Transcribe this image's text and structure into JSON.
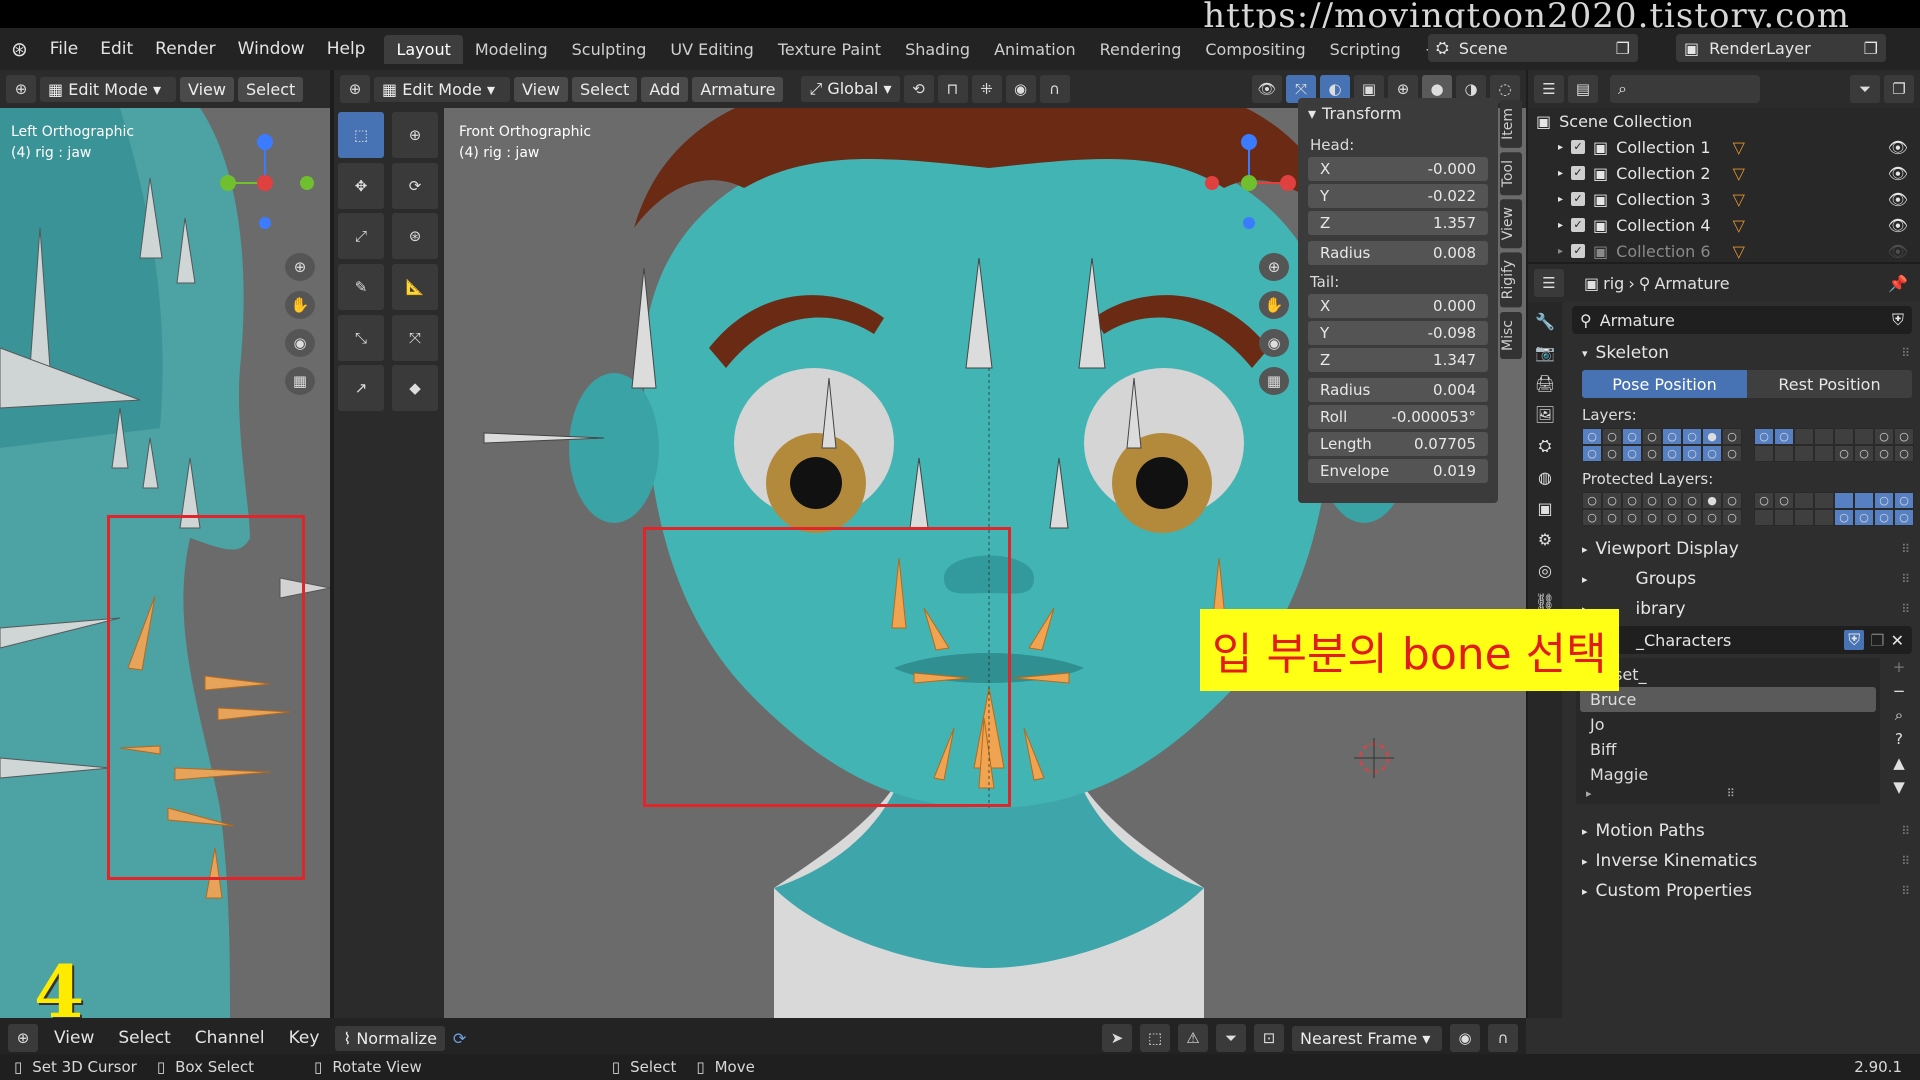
{
  "watermark": "https://movingtoon2020.tistory.com",
  "menu": [
    "File",
    "Edit",
    "Render",
    "Window",
    "Help"
  ],
  "workspaces": [
    "Layout",
    "Modeling",
    "Sculpting",
    "UV Editing",
    "Texture Paint",
    "Shading",
    "Animation",
    "Rendering",
    "Compositing",
    "Scripting"
  ],
  "scene": {
    "label": "Scene",
    "layer": "RenderLayer"
  },
  "left_view": {
    "mode": "Edit Mode",
    "view": "View",
    "select": "Select",
    "title": "Left Orthographic",
    "subtitle": "(4) rig : jaw"
  },
  "main_view": {
    "mode": "Edit Mode",
    "view": "View",
    "select": "Select",
    "add": "Add",
    "armature": "Armature",
    "orientation": "Global",
    "title": "Front Orthographic",
    "subtitle": "(4) rig : jaw"
  },
  "transform": {
    "title": "Transform",
    "head_label": "Head:",
    "tail_label": "Tail:",
    "head": [
      {
        "k": "X",
        "v": "-0.000"
      },
      {
        "k": "Y",
        "v": "-0.022"
      },
      {
        "k": "Z",
        "v": "1.357"
      },
      {
        "k": "Radius",
        "v": "0.008"
      }
    ],
    "tail": [
      {
        "k": "X",
        "v": "0.000"
      },
      {
        "k": "Y",
        "v": "-0.098"
      },
      {
        "k": "Z",
        "v": "1.347"
      },
      {
        "k": "Radius",
        "v": "0.004"
      }
    ],
    "extra": [
      {
        "k": "Roll",
        "v": "-0.000053°"
      },
      {
        "k": "Length",
        "v": "0.07705"
      },
      {
        "k": "Envelope",
        "v": "0.019"
      }
    ]
  },
  "side_tabs": [
    "Item",
    "Tool",
    "View",
    "Rigify",
    "Misc"
  ],
  "outliner": {
    "root": "Scene Collection",
    "items": [
      "Collection 1",
      "Collection 2",
      "Collection 3",
      "Collection 4",
      "Collection 6"
    ]
  },
  "properties": {
    "breadcrumb_obj": "rig",
    "breadcrumb_data": "Armature",
    "data_name": "Armature",
    "skeleton": "Skeleton",
    "pose_position": "Pose Position",
    "rest_position": "Rest Position",
    "layers": "Layers:",
    "protected_layers": "Protected Layers:",
    "viewport_display": "Viewport Display",
    "groups": "Groups",
    "library": "ibrary",
    "characters": "_Characters",
    "char_list": [
      "_reset_",
      "Bruce",
      "Jo",
      "Biff",
      "Maggie"
    ],
    "motion_paths": "Motion Paths",
    "inverse_kinematics": "Inverse Kinematics",
    "custom_properties": "Custom Properties"
  },
  "overlay_caption": "입 부분의 bone 선택",
  "step_number": "4",
  "timeline": {
    "menu": [
      "View",
      "Select",
      "Channel",
      "Key"
    ],
    "normalize": "Normalize",
    "snap": "Nearest Frame"
  },
  "status": {
    "cursor": "Set 3D Cursor",
    "box": "Box Select",
    "rotate": "Rotate View",
    "select": "Select",
    "move": "Move",
    "version": "2.90.1"
  }
}
